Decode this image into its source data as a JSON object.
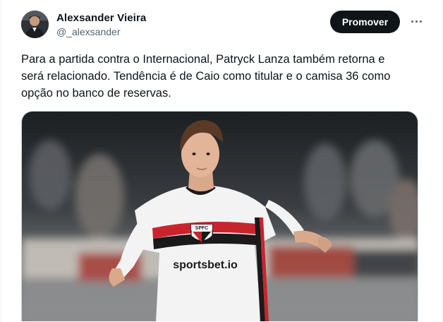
{
  "author": {
    "name": "Alexsander Vieira",
    "handle": "@_alexsander"
  },
  "actions": {
    "promote_label": "Promover",
    "more_icon": "ellipsis-icon"
  },
  "tweet": {
    "lines": [
      "Para a partida contra o Internacional, Patryck Lanza também retorna e",
      "será relacionado. Tendência é de Caio como titular e o camisa 36 como",
      "opção no banco de reservas."
    ]
  },
  "media": {
    "badge_text": "SPFC",
    "sponsor_text": "sportsbet.io"
  }
}
